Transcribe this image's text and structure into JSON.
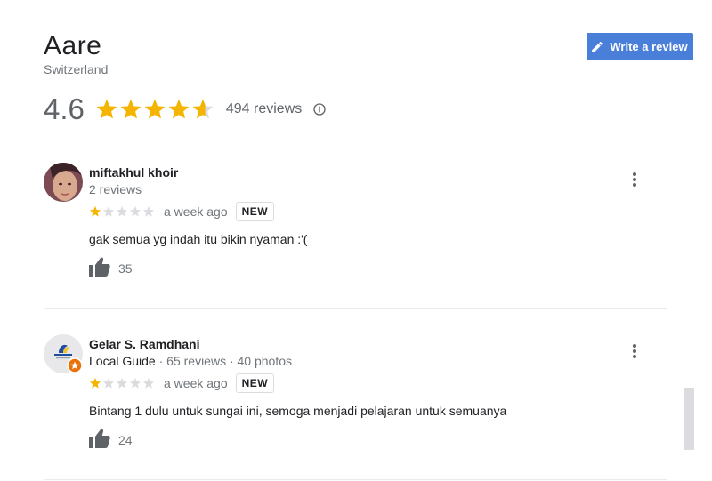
{
  "place": {
    "title": "Aare",
    "subtitle": "Switzerland",
    "rating": "4.6",
    "rating_value": 4.6,
    "review_count": "494 reviews",
    "write_review_label": "Write a review"
  },
  "colors": {
    "star_filled": "#f4b400",
    "star_empty": "#dadce0",
    "button": "#4a7fd9"
  },
  "reviews": [
    {
      "name": "miftakhul khoir",
      "local_guide": "",
      "meta": "2 reviews",
      "stars": 1,
      "time": "a week ago",
      "badge": "NEW",
      "text": "gak semua yg indah itu bikin nyaman :'(",
      "likes": "35"
    },
    {
      "name": "Gelar S. Ramdhani",
      "local_guide": "Local Guide",
      "meta": " · 65 reviews · 40 photos",
      "stars": 1,
      "time": "a week ago",
      "badge": "NEW",
      "text": "Bintang 1 dulu untuk sungai ini, semoga menjadi pelajaran untuk semuanya",
      "likes": "24"
    }
  ],
  "icons": {
    "write": "pencil-icon",
    "info": "info-icon",
    "like": "thumbs-up-icon",
    "more": "more-vert-icon"
  }
}
